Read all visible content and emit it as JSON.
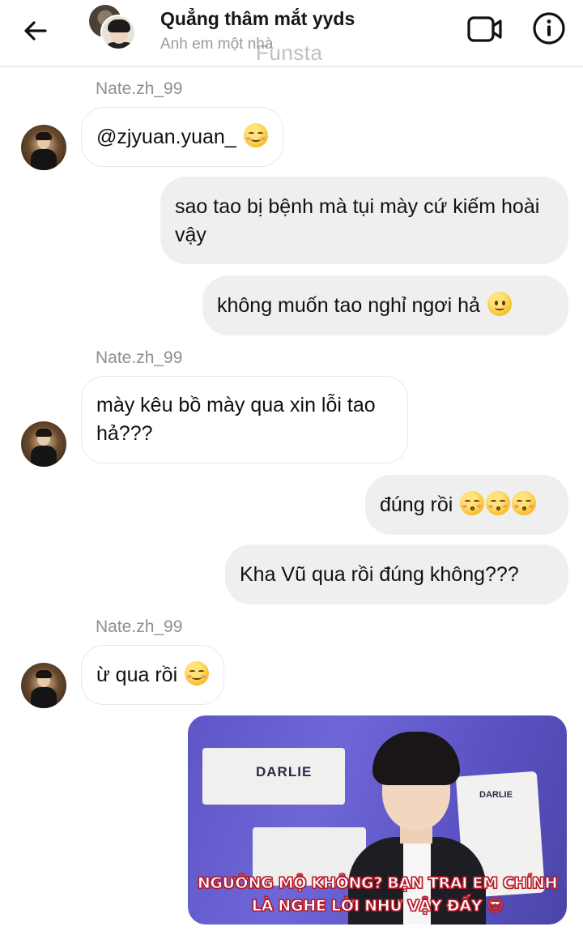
{
  "header": {
    "title": "Quẳng thâm mắt yyds",
    "subtitle": "Anh em một nhà",
    "watermark": "Funsta"
  },
  "messages": [
    {
      "sender": "Nate.zh_99",
      "text": "@zjyuan.yuan_",
      "emoji": "smiling-face"
    },
    {
      "text": "sao tao bị bệnh mà tụi mày cứ kiếm hoài vậy"
    },
    {
      "text": "không muốn tao nghỉ ngơi hả",
      "emoji": "slightly-smiling-face"
    },
    {
      "sender": "Nate.zh_99",
      "text": "mày kêu bồ mày qua xin lỗi tao hả???"
    },
    {
      "text": "đúng rồi",
      "emoji": "kissing-face x3"
    },
    {
      "text": "Kha Vũ qua rồi đúng không???"
    },
    {
      "sender": "Nate.zh_99",
      "text": "ừ qua rồi",
      "emoji": "smiling-face"
    }
  ],
  "photo": {
    "brand": "DARLIE",
    "brand_small": "DARLIE",
    "caption_line1": "NGƯỠNG MỘ KHÔNG? BẠN TRAI EM CHÍNH",
    "caption_line2": "LÀ NGHE LỜI NHƯ VẬY ĐẤY 😎"
  }
}
